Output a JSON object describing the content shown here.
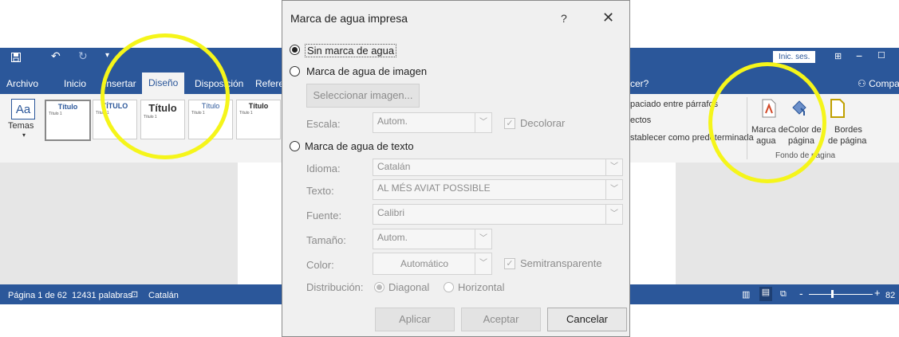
{
  "word": {
    "quick_access": {
      "save_icon": "save-icon",
      "undo_icon": "undo-icon",
      "redo_icon": "redo-icon"
    },
    "tabs": [
      "Archivo",
      "Inicio",
      "Insertar",
      "Diseño",
      "Disposición",
      "Referen"
    ],
    "active_tab": "Diseño",
    "sign_in": "Inic. ses.",
    "search_hint": "cer?",
    "share": "Compar",
    "ribbon": {
      "themes_label": "Temas",
      "styles": [
        {
          "title": "Título",
          "subtitle": "Título 1"
        },
        {
          "title": "TÍTULO",
          "subtitle": "Título 1"
        },
        {
          "title": "Título",
          "subtitle": "Título 1"
        },
        {
          "title": "Título",
          "subtitle": "Título 1"
        },
        {
          "title": "Título",
          "subtitle": "Título 1"
        }
      ],
      "paragraph_spacing": "paciado entre párrafos",
      "effects": "ectos",
      "set_default": "stablecer como predeterminada",
      "watermark_label": [
        "Marca de",
        "agua"
      ],
      "page_color_label": [
        "Color de",
        "página"
      ],
      "page_borders_label": [
        "Bordes",
        "de página"
      ],
      "group_label": "Fondo de página"
    },
    "status": {
      "page": "Página 1 de 62",
      "words": "12431 palabras",
      "language": "Catalán",
      "zoom": "82"
    }
  },
  "dialog": {
    "title": "Marca de agua impresa",
    "help": "?",
    "close": "✕",
    "options": {
      "none": "Sin marca de agua",
      "picture": "Marca de agua de imagen",
      "text": "Marca de agua de texto"
    },
    "selected_option": "none",
    "picture": {
      "select_button": "Seleccionar imagen...",
      "scale_label": "Escala:",
      "scale_value": "Autom.",
      "washout_label": "Decolorar",
      "washout_checked": true
    },
    "text": {
      "language_label": "Idioma:",
      "language_value": "Catalán",
      "text_label": "Texto:",
      "text_value": "AL MÉS AVIAT POSSIBLE",
      "font_label": "Fuente:",
      "font_value": "Calibri",
      "size_label": "Tamaño:",
      "size_value": "Autom.",
      "color_label": "Color:",
      "color_value": "Automático",
      "semitransparent_label": "Semitransparente",
      "semitransparent_checked": true,
      "layout_label": "Distribución:",
      "layout_diagonal": "Diagonal",
      "layout_horizontal": "Horizontal",
      "layout_selected": "Diagonal"
    },
    "buttons": {
      "apply": "Aplicar",
      "ok": "Aceptar",
      "cancel": "Cancelar"
    }
  },
  "colors": {
    "word_blue": "#2b579a",
    "highlight": "#f5f51a",
    "dialog_bg": "#f0f0f0"
  }
}
